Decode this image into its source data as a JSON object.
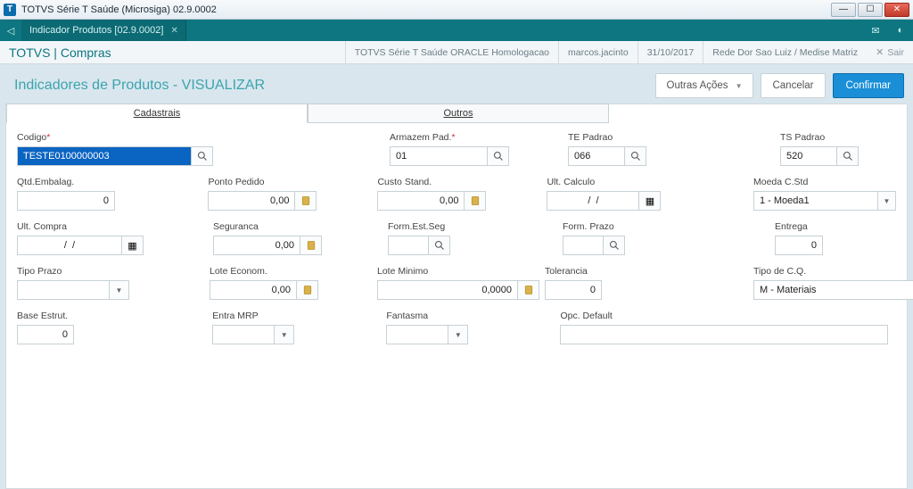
{
  "window": {
    "title": "TOTVS Série T Saúde (Microsiga) 02.9.0002"
  },
  "tealbar": {
    "tab": "Indicador Produtos [02.9.0002]"
  },
  "module": {
    "brand": "TOTVS | Compras",
    "env": "TOTVS Série T Saúde ORACLE Homologacao",
    "user": "marcos.jacinto",
    "date": "31/10/2017",
    "org": "Rede Dor Sao Luiz / Medise Matriz",
    "exit": "Sair"
  },
  "page": {
    "title": "Indicadores de Produtos - VISUALIZAR",
    "outras": "Outras Ações",
    "cancel": "Cancelar",
    "confirm": "Confirmar"
  },
  "tabs": {
    "cadastrais": "Cadastrais",
    "outros": "Outros"
  },
  "f": {
    "codigo_l": "Codigo",
    "codigo_v": "TESTE0100000003",
    "armazem_l": "Armazem Pad.",
    "armazem_v": "01",
    "tepad_l": "TE Padrao",
    "tepad_v": "066",
    "tspad_l": "TS Padrao",
    "tspad_v": "520",
    "qtdemb_l": "Qtd.Embalag.",
    "qtdemb_v": "0",
    "ponto_l": "Ponto Pedido",
    "ponto_v": "0,00",
    "custo_l": "Custo Stand.",
    "custo_v": "0,00",
    "ultcalc_l": "Ult. Calculo",
    "ultcalc_v": "/  /",
    "moeda_l": "Moeda C.Std",
    "moeda_v": "1 - Moeda1",
    "ultcompra_l": "Ult. Compra",
    "ultcompra_v": "/  /",
    "seg_l": "Seguranca",
    "seg_v": "0,00",
    "formest_l": "Form.Est.Seg",
    "formprazo_l": "Form. Prazo",
    "entrega_l": "Entrega",
    "entrega_v": "0",
    "tipoprazo_l": "Tipo Prazo",
    "loteecon_l": "Lote Econom.",
    "loteecon_v": "0,00",
    "lotemin_l": "Lote Minimo",
    "lotemin_v": "0,0000",
    "toler_l": "Tolerancia",
    "toler_v": "0",
    "tipocq_l": "Tipo de C.Q.",
    "tipocq_v": "M - Materiais",
    "base_l": "Base Estrut.",
    "base_v": "0",
    "entramrp_l": "Entra MRP",
    "fantasma_l": "Fantasma",
    "opcdef_l": "Opc. Default"
  }
}
